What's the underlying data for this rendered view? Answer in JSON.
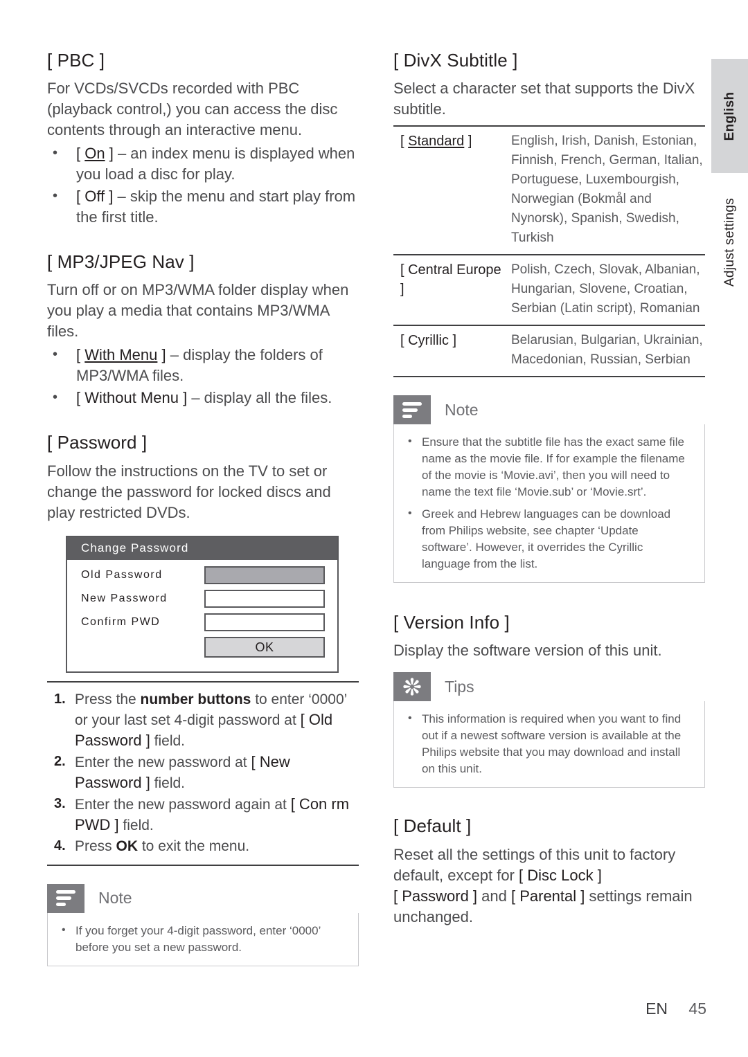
{
  "left_column": {
    "pbc": {
      "heading": "[ PBC ]",
      "intro": "For VCDs/SVCDs recorded with PBC (playback control,) you can access the disc contents through an interactive menu.",
      "options": [
        {
          "token": "[ On ]",
          "token_underline": "On",
          "desc": "– an index menu is displayed when you load a disc for play."
        },
        {
          "token": "[ Off ]",
          "token_underline": "",
          "desc": "– skip the menu and start play from the first title."
        }
      ]
    },
    "mp3_jpeg_nav": {
      "heading": "[ MP3/JPEG Nav ]",
      "intro": "Turn off or on MP3/WMA folder display when you play a media that contains MP3/WMA files.",
      "options": [
        {
          "token": "[ With Menu ]",
          "token_underline": "With Menu",
          "desc": "– display the folders of MP3/WMA files."
        },
        {
          "token": "[ Without Menu ]",
          "token_underline": "",
          "desc": "– display all the files."
        }
      ]
    },
    "password": {
      "heading": "[ Password ]",
      "intro": "Follow the instructions on the TV to set or change the password for locked discs and play restricted DVDs.",
      "dialog": {
        "title": "Change Password",
        "rows": [
          {
            "label": "Old Password",
            "state": "filled"
          },
          {
            "label": "New Password",
            "state": "empty"
          },
          {
            "label": "Confirm PWD",
            "state": "empty"
          }
        ],
        "ok_label": "OK"
      },
      "steps": [
        {
          "num": "1.",
          "part1": "Press the ",
          "bold1": "number buttons",
          "part2": " to enter ‘0000’ or your last set 4-digit password at ",
          "bracket": "[ Old Password ]",
          "part3": " field."
        },
        {
          "num": "2.",
          "part1": "Enter the new password at ",
          "bold1": "",
          "part2": "",
          "bracket": "[ New Password ]",
          "part3": " field."
        },
        {
          "num": "3.",
          "part1": "Enter the new password again at ",
          "bold1": "",
          "part2": "",
          "bracket": "[ Con rm PWD ]",
          "part3": " field."
        },
        {
          "num": "4.",
          "part1": "Press ",
          "bold1": "OK",
          "part2": "",
          "bracket": "",
          "part3": " to exit the menu."
        }
      ],
      "note": {
        "icon": "note-icon",
        "title": "Note",
        "items": [
          "If you forget your 4-digit password, enter ‘0000’ before you set a new password."
        ]
      }
    }
  },
  "right_column": {
    "divx_subtitle": {
      "heading": "[ DivX Subtitle ]",
      "intro": "Select a character set that supports the DivX subtitle.",
      "table": {
        "rows": [
          {
            "key": "[ Standard ]",
            "key_underline": "Standard",
            "value": "English, Irish, Danish, Estonian, Finnish, French, German, Italian, Portuguese, Luxembourgish, Norwegian (Bokmål and Nynorsk), Spanish, Swedish, Turkish"
          },
          {
            "key": "[ Central Europe ]",
            "key_underline": "",
            "value": "Polish, Czech, Slovak, Albanian, Hungarian, Slovene, Croatian, Serbian (Latin script), Romanian"
          },
          {
            "key": "[ Cyrillic ]",
            "key_underline": "",
            "value": "Belarusian, Bulgarian, Ukrainian, Macedonian, Russian, Serbian"
          }
        ]
      },
      "note": {
        "icon": "note-icon",
        "title": "Note",
        "items": [
          "Ensure that the subtitle file has the exact same file name as the movie file. If for example the filename of the movie is ‘Movie.avi’, then you will need to name the text file ‘Movie.sub’ or ‘Movie.srt’.",
          "Greek and Hebrew languages can be download from Philips website, see chapter ‘Update software’. However, it overrides the Cyrillic language from the list."
        ]
      }
    },
    "version_info": {
      "heading": "[ Version Info ]",
      "intro": "Display the software version of this unit.",
      "tips": {
        "icon": "tips-asterisk-icon",
        "title": "Tips",
        "items": [
          "This information is required when you want to find out if a newest software version is available at the Philips website that you may download and install on this unit."
        ]
      }
    },
    "default": {
      "heading": "[ Default ]",
      "line1": "Reset all the settings of this unit to factory default, except for ",
      "tok1": "[ Disc Lock ]",
      "tok2": "[ Password ]",
      "mid": " and ",
      "tok3": "[ Parental ]",
      "tail": " settings remain unchanged."
    }
  },
  "margin_tabs": {
    "language_tab": "English",
    "chapter_tab": "Adjust settings"
  },
  "footer": {
    "lang_code": "EN",
    "page_number": "45"
  },
  "colors": {
    "tab_background": "#d4d5d7",
    "callout_badge": "#7c7c80",
    "dialog_title_bar": "#5e5e61",
    "dialog_filled_field": "#a9a9ae",
    "rule": "#3f3f41"
  }
}
